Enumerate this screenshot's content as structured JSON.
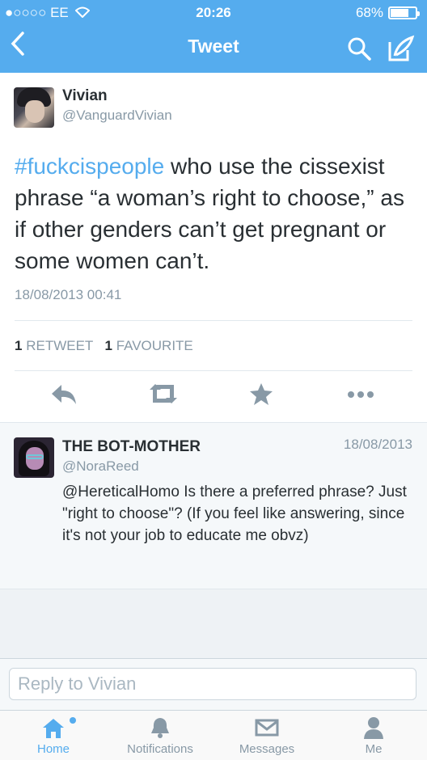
{
  "status_bar": {
    "carrier": "●○○○○ EE",
    "time": "20:26",
    "battery_percent": "68%",
    "battery_level": 0.68
  },
  "nav": {
    "title": "Tweet"
  },
  "tweet": {
    "author_name": "Vivian",
    "author_handle": "@VanguardVivian",
    "hashtag": "#fuckcispeople",
    "text": " who use the cissexist phrase “a woman’s right to choose,” as if other genders can’t get pregnant or some women can’t.",
    "timestamp": "18/08/2013 00:41",
    "retweet_count": "1",
    "retweet_label": "RETWEET",
    "favourite_count": "1",
    "favourite_label": "FAVOURITE"
  },
  "reply_tweet": {
    "author_name": "THE BOT-MOTHER",
    "author_handle": "@NoraReed",
    "date": "18/08/2013",
    "text": "@HereticalHomo Is there a preferred phrase? Just \"right to choose\"? (If you feel like answering, since it's not your job to educate me obvz)"
  },
  "reply_box": {
    "placeholder": "Reply to Vivian"
  },
  "tabs": [
    {
      "label": "Home",
      "icon": "home-icon",
      "active": true
    },
    {
      "label": "Notifications",
      "icon": "bell-icon",
      "active": false
    },
    {
      "label": "Messages",
      "icon": "envelope-icon",
      "active": false
    },
    {
      "label": "Me",
      "icon": "person-icon",
      "active": false
    }
  ],
  "colors": {
    "brand": "#55acee",
    "text": "#292f33",
    "muted": "#8899a6"
  }
}
